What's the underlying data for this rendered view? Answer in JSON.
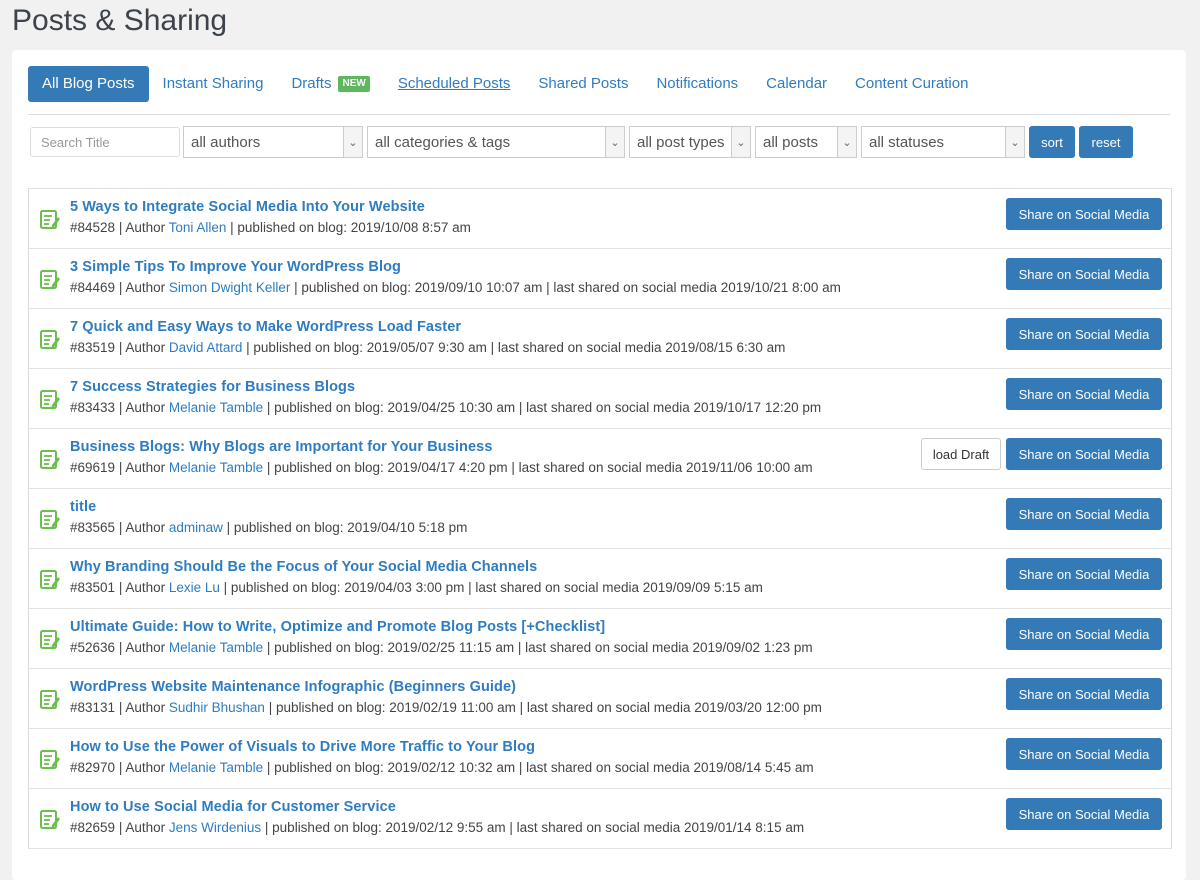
{
  "page_title": "Posts & Sharing",
  "tabs": [
    {
      "label": "All Blog Posts",
      "active": true
    },
    {
      "label": "Instant Sharing"
    },
    {
      "label": "Drafts",
      "badge": "NEW"
    },
    {
      "label": "Scheduled Posts"
    },
    {
      "label": "Shared Posts"
    },
    {
      "label": "Notifications"
    },
    {
      "label": "Calendar"
    },
    {
      "label": "Content Curation"
    }
  ],
  "filters": {
    "search_placeholder": "Search Title",
    "authors": "all authors",
    "categories": "all categories & tags",
    "post_types": "all post types",
    "posts": "all posts",
    "statuses": "all statuses",
    "sort_label": "sort",
    "reset_label": "reset"
  },
  "colors": {
    "accent": "#337ab7",
    "link": "#2f7cc0",
    "badge": "#5cb85c"
  },
  "share_label": "Share on Social Media",
  "load_draft_label": "load Draft",
  "posts": [
    {
      "title": "5 Ways to Integrate Social Media Into Your Website",
      "id": "#84528",
      "author": "Toni Allen",
      "published": "2019/10/08 8:57 am",
      "shared": ""
    },
    {
      "title": "3 Simple Tips To Improve Your WordPress Blog",
      "id": "#84469",
      "author": "Simon Dwight Keller",
      "published": "2019/09/10 10:07 am",
      "shared": "2019/10/21 8:00 am"
    },
    {
      "title": "7 Quick and Easy Ways to Make WordPress Load Faster",
      "id": "#83519",
      "author": "David Attard",
      "published": "2019/05/07 9:30 am",
      "shared": "2019/08/15 6:30 am"
    },
    {
      "title": "7 Success Strategies for Business Blogs",
      "id": "#83433",
      "author": "Melanie Tamble",
      "published": "2019/04/25 10:30 am",
      "shared": "2019/10/17 12:20 pm"
    },
    {
      "title": "Business Blogs: Why Blogs are Important for Your Business",
      "id": "#69619",
      "author": "Melanie Tamble",
      "published": "2019/04/17 4:20 pm",
      "shared": "2019/11/06 10:00 am",
      "load_draft": true
    },
    {
      "title": "title",
      "id": "#83565",
      "author": "adminaw",
      "published": "2019/04/10 5:18 pm",
      "shared": ""
    },
    {
      "title": "Why Branding Should Be the Focus of Your Social Media Channels",
      "id": "#83501",
      "author": "Lexie Lu",
      "published": "2019/04/03 3:00 pm",
      "shared": "2019/09/09 5:15 am"
    },
    {
      "title": "Ultimate Guide: How to Write, Optimize and Promote Blog Posts [+Checklist]",
      "id": "#52636",
      "author": "Melanie Tamble",
      "published": "2019/02/25 11:15 am",
      "shared": "2019/09/02 1:23 pm"
    },
    {
      "title": "WordPress Website Maintenance Infographic (Beginners Guide)",
      "id": "#83131",
      "author": "Sudhir Bhushan",
      "published": "2019/02/19 11:00 am",
      "shared": "2019/03/20 12:00 pm"
    },
    {
      "title": "How to Use the Power of Visuals to Drive More Traffic to Your Blog",
      "id": "#82970",
      "author": "Melanie Tamble",
      "published": "2019/02/12 10:32 am",
      "shared": "2019/08/14 5:45 am"
    },
    {
      "title": "How to Use Social Media for Customer Service",
      "id": "#82659",
      "author": "Jens Wirdenius",
      "published": "2019/02/12 9:55 am",
      "shared": "2019/01/14 8:15 am"
    }
  ],
  "meta_text": {
    "author_prefix": " | Author ",
    "published_prefix": " | published on blog: ",
    "shared_prefix": " | last shared on social media "
  }
}
